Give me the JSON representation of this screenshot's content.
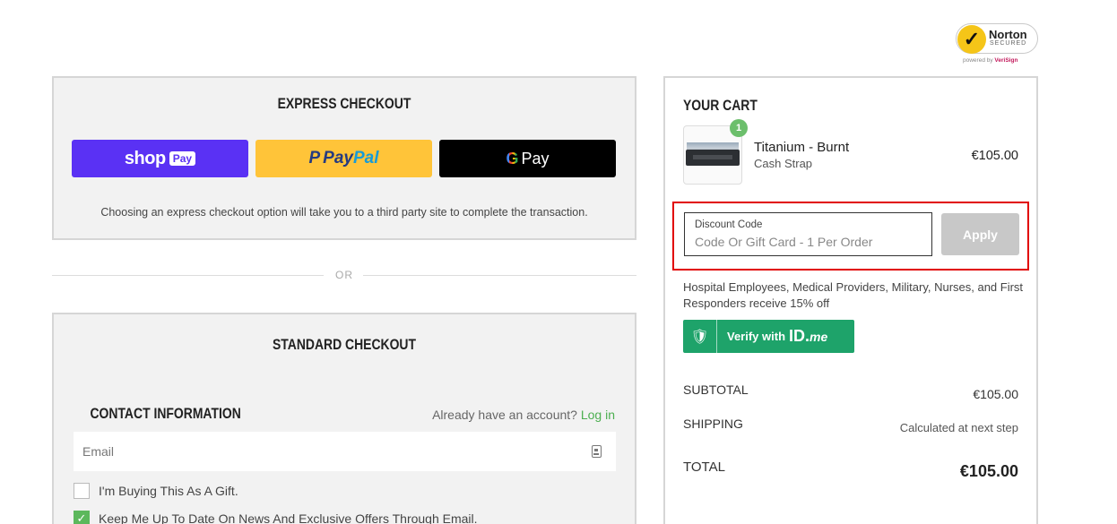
{
  "norton": {
    "brand": "Norton",
    "secured": "SECURED",
    "powered_prefix": "powered by ",
    "powered_brand": "VeriSign"
  },
  "express": {
    "title": "EXPRESS CHECKOUT",
    "shop_pay": {
      "shop": "shop",
      "pay": "Pay"
    },
    "paypal": {
      "mark": "P",
      "pay": "Pay",
      "pal": "Pal"
    },
    "gpay": {
      "g": "G",
      "pay": "Pay"
    },
    "note": "Choosing an express checkout option will take you to a third party site to complete the transaction."
  },
  "divider": {
    "or": "OR"
  },
  "standard": {
    "title": "STANDARD CHECKOUT",
    "contact_title": "CONTACT INFORMATION",
    "have_account": "Already have an account?",
    "login": "Log in",
    "email_placeholder": "Email",
    "gift_label": "I'm Buying This As A Gift.",
    "gift_checked": false,
    "newsletter_label": "Keep Me Up To Date On News And Exclusive Offers Through Email.",
    "newsletter_checked": true
  },
  "cart": {
    "title": "YOUR CART",
    "item": {
      "quantity": "1",
      "name": "Titanium - Burnt",
      "variant": "Cash Strap",
      "price": "€105.00"
    },
    "discount": {
      "label": "Discount Code",
      "placeholder": "Code Or Gift Card - 1 Per Order",
      "apply": "Apply"
    },
    "promo": "Hospital Employees, Medical Providers, Military, Nurses, and First Responders receive 15% off",
    "idme": {
      "verify": "Verify with",
      "id": "ID.",
      "me": "me"
    },
    "subtotal_label": "SUBTOTAL",
    "subtotal_value": "€105.00",
    "shipping_label": "SHIPPING",
    "shipping_value": "Calculated at next step",
    "total_label": "TOTAL",
    "total_value": "€105.00"
  },
  "colors": {
    "shop_pay": "#5a31f4",
    "paypal": "#ffc439",
    "gpay": "#000000",
    "accent_green": "#4caf50",
    "idme": "#1ea36a",
    "highlight": "#e10000"
  }
}
